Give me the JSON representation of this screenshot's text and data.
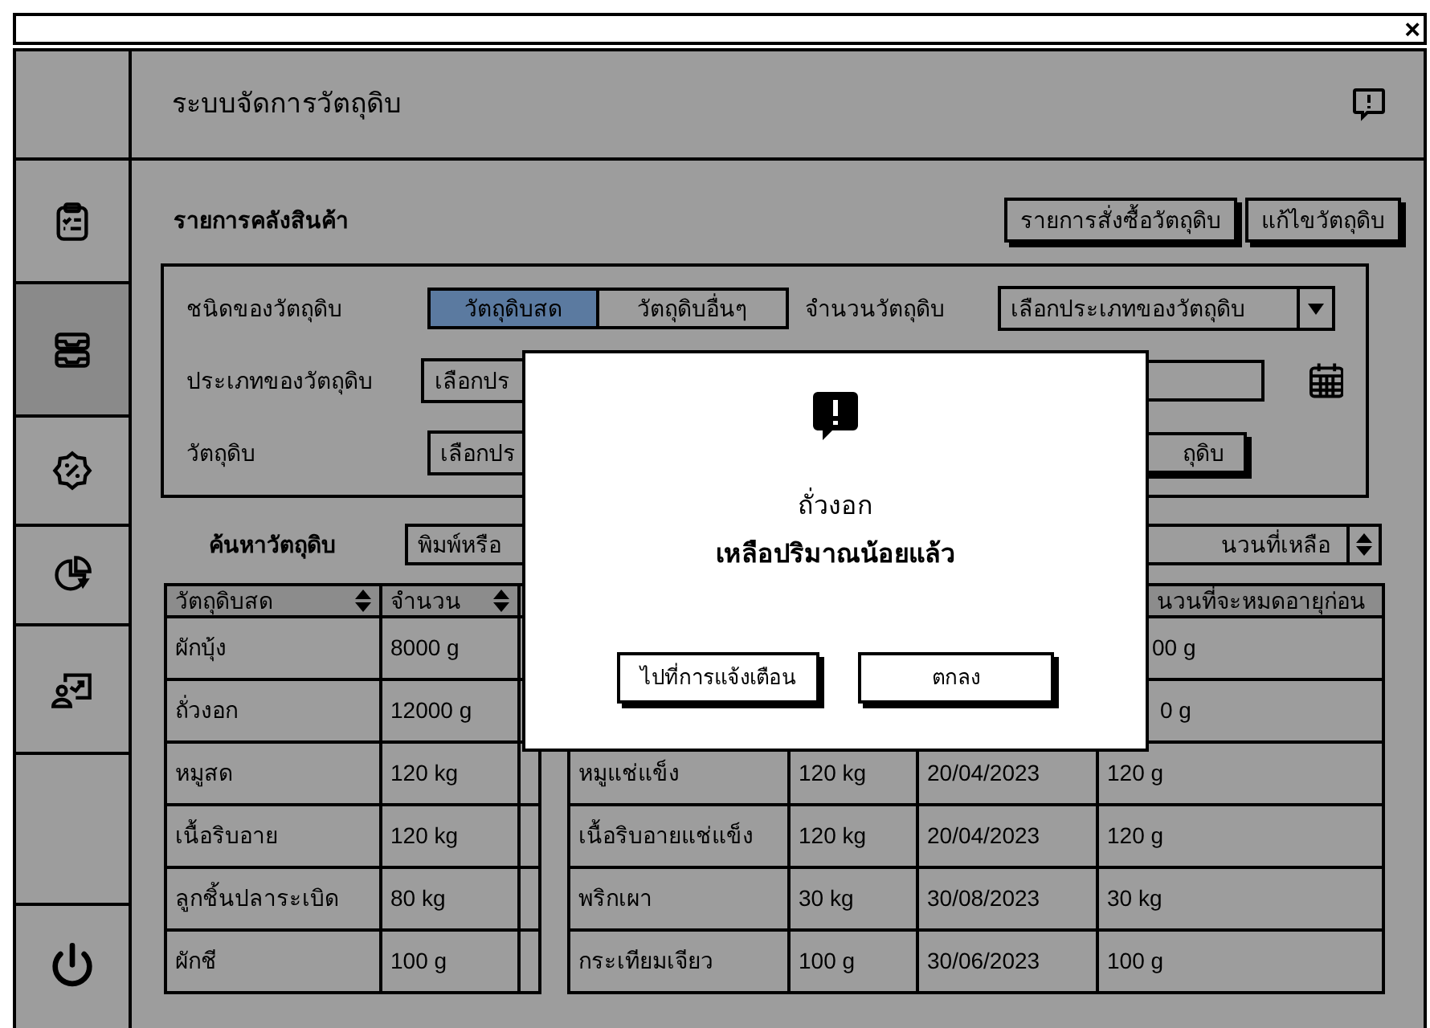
{
  "window": {
    "close": "×"
  },
  "app": {
    "title": "ระบบจัดการวัตถุดิบ"
  },
  "sidebar": {
    "items": [
      {
        "selected": false
      },
      {
        "selected": true
      },
      {
        "selected": false
      },
      {
        "selected": false
      },
      {
        "selected": false
      }
    ]
  },
  "section": {
    "title": "รายการคลังสินค้า",
    "buttons": [
      "รายการสั่งซื้อวัตถุดิบ",
      "แก้ไขวัตถุดิบ"
    ]
  },
  "filters": {
    "type_label": "ชนิดของวัตถุดิบ",
    "segments": [
      {
        "label": "วัตถุดิบสด",
        "selected": true
      },
      {
        "label": "วัตถุดิบอื่นๆ",
        "selected": false
      }
    ],
    "amount_label": "จำนวนวัตถุดิบ",
    "amount_select": "เลือกประเภทของวัตถุดิบ",
    "category_label": "ประเภทของวัตถุดิบ",
    "category_field": "เลือกปร",
    "material_label": "วัตถุดิบ",
    "material_field": "เลือกปร",
    "material_button": "ถุดิบ"
  },
  "search": {
    "label": "ค้นหาวัตถุดิบ",
    "placeholder": "พิมพ์หรือ",
    "sort_select": "นวนที่เหลือ"
  },
  "left_table": {
    "columns": [
      "วัตถุดิบสด",
      "จำนวน"
    ],
    "rows": [
      [
        "ผักบุ้ง",
        "8000 g"
      ],
      [
        "ถั่วงอก",
        "12000 g"
      ],
      [
        "หมูสด",
        "120 kg"
      ],
      [
        "เนื้อริบอาย",
        "120 kg"
      ],
      [
        "ลูกชิ้นปลาระเบิด",
        "80 kg"
      ],
      [
        "ผักชี",
        "100 g"
      ]
    ]
  },
  "right_table": {
    "column_4": "นวนที่จะหมดอายุก่อน",
    "rows": [
      {
        "column_4": "00 g"
      },
      {
        "column_4": "0 g"
      },
      {
        "column_1": "หมูแช่แข็ง",
        "column_2": "120 kg",
        "column_3": "20/04/2023",
        "column_4": "120 g"
      },
      {
        "column_1": "เนื้อริบอายแช่แข็ง",
        "column_2": "120 kg",
        "column_3": "20/04/2023",
        "column_4": "120 g"
      },
      {
        "column_1": "พริกเผา",
        "column_2": "30 kg",
        "column_3": "30/08/2023",
        "column_4": "30 kg"
      },
      {
        "column_1": "กระเทียมเจียว",
        "column_2": "100 g",
        "column_3": "30/06/2023",
        "column_4": "100 g"
      }
    ]
  },
  "dialog": {
    "title": "ถั่วงอก",
    "message": "เหลือปริมาณน้อยแล้ว",
    "buttons": [
      "ไปที่การแจ้งเตือน",
      "ตกลง"
    ]
  }
}
